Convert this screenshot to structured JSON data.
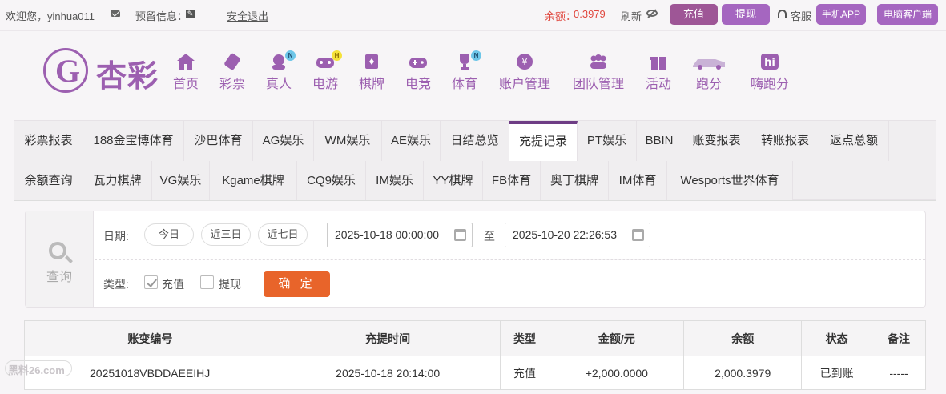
{
  "topbar": {
    "welcome": "欢迎您，yinhua011",
    "reserved_info": "预留信息：",
    "logout": "安全退出",
    "balance_label": "余额：",
    "balance_value": "0.3979",
    "refresh": "刷新",
    "recharge": "充值",
    "withdraw": "提现",
    "service": "客服",
    "mobile_app": "手机APP",
    "pc_client": "电脑客户端"
  },
  "logo": {
    "text": "杏彩"
  },
  "nav": [
    {
      "label": "首页",
      "icon": "home-icon"
    },
    {
      "label": "彩票",
      "icon": "lottery-icon"
    },
    {
      "label": "真人",
      "icon": "live-dealer-icon",
      "badge": "N"
    },
    {
      "label": "电游",
      "icon": "slot-game-icon",
      "badge": "H"
    },
    {
      "label": "棋牌",
      "icon": "cards-icon"
    },
    {
      "label": "电竞",
      "icon": "gamepad-icon"
    },
    {
      "label": "体育",
      "icon": "trophy-icon",
      "badge": "N"
    },
    {
      "label": "账户管理",
      "icon": "yen-icon"
    },
    {
      "label": "团队管理",
      "icon": "team-icon"
    },
    {
      "label": "活动",
      "icon": "gift-icon"
    },
    {
      "label": "跑分",
      "icon": "car-icon"
    },
    {
      "label": "嗨跑分",
      "icon": "hi-icon"
    }
  ],
  "tabs_row1": [
    "彩票报表",
    "188金宝博体育",
    "沙巴体育",
    "AG娱乐",
    "WM娱乐",
    "AE娱乐",
    "日结总览",
    "充提记录",
    "PT娱乐",
    "BBIN",
    "账变报表",
    "转账报表",
    "返点总额"
  ],
  "tabs_row2": [
    "余额查询",
    "瓦力棋牌",
    "VG娱乐",
    "Kgame棋牌",
    "CQ9娱乐",
    "IM娱乐",
    "YY棋牌",
    "FB体育",
    "奥丁棋牌",
    "IM体育",
    "Wesports世界体育"
  ],
  "active_tab": "充提记录",
  "query": {
    "side_label": "查询",
    "date_label": "日期:",
    "today": "今日",
    "three_days": "近三日",
    "seven_days": "近七日",
    "start_date": "2025-10-18 00:00:00",
    "to": "至",
    "end_date": "2025-10-20 22:26:53",
    "type_label": "类型:",
    "type_recharge": "充值",
    "type_withdraw": "提现",
    "confirm": "确 定"
  },
  "table": {
    "headers": [
      "账变编号",
      "充提时间",
      "类型",
      "金额/元",
      "余额",
      "状态",
      "备注"
    ],
    "rows": [
      [
        "20251018VBDDAEEIHJ",
        "2025-10-18 20:14:00",
        "充值",
        "+2,000.0000",
        "2,000.3979",
        "已到账",
        "-----"
      ]
    ]
  },
  "watermark": "黑料26.com",
  "colors": {
    "brand": "#9c5fb0",
    "active_tab": "#6e3d85",
    "confirm": "#e8642a",
    "balance": "#e0463d",
    "status_ok": "#2ca02c"
  }
}
